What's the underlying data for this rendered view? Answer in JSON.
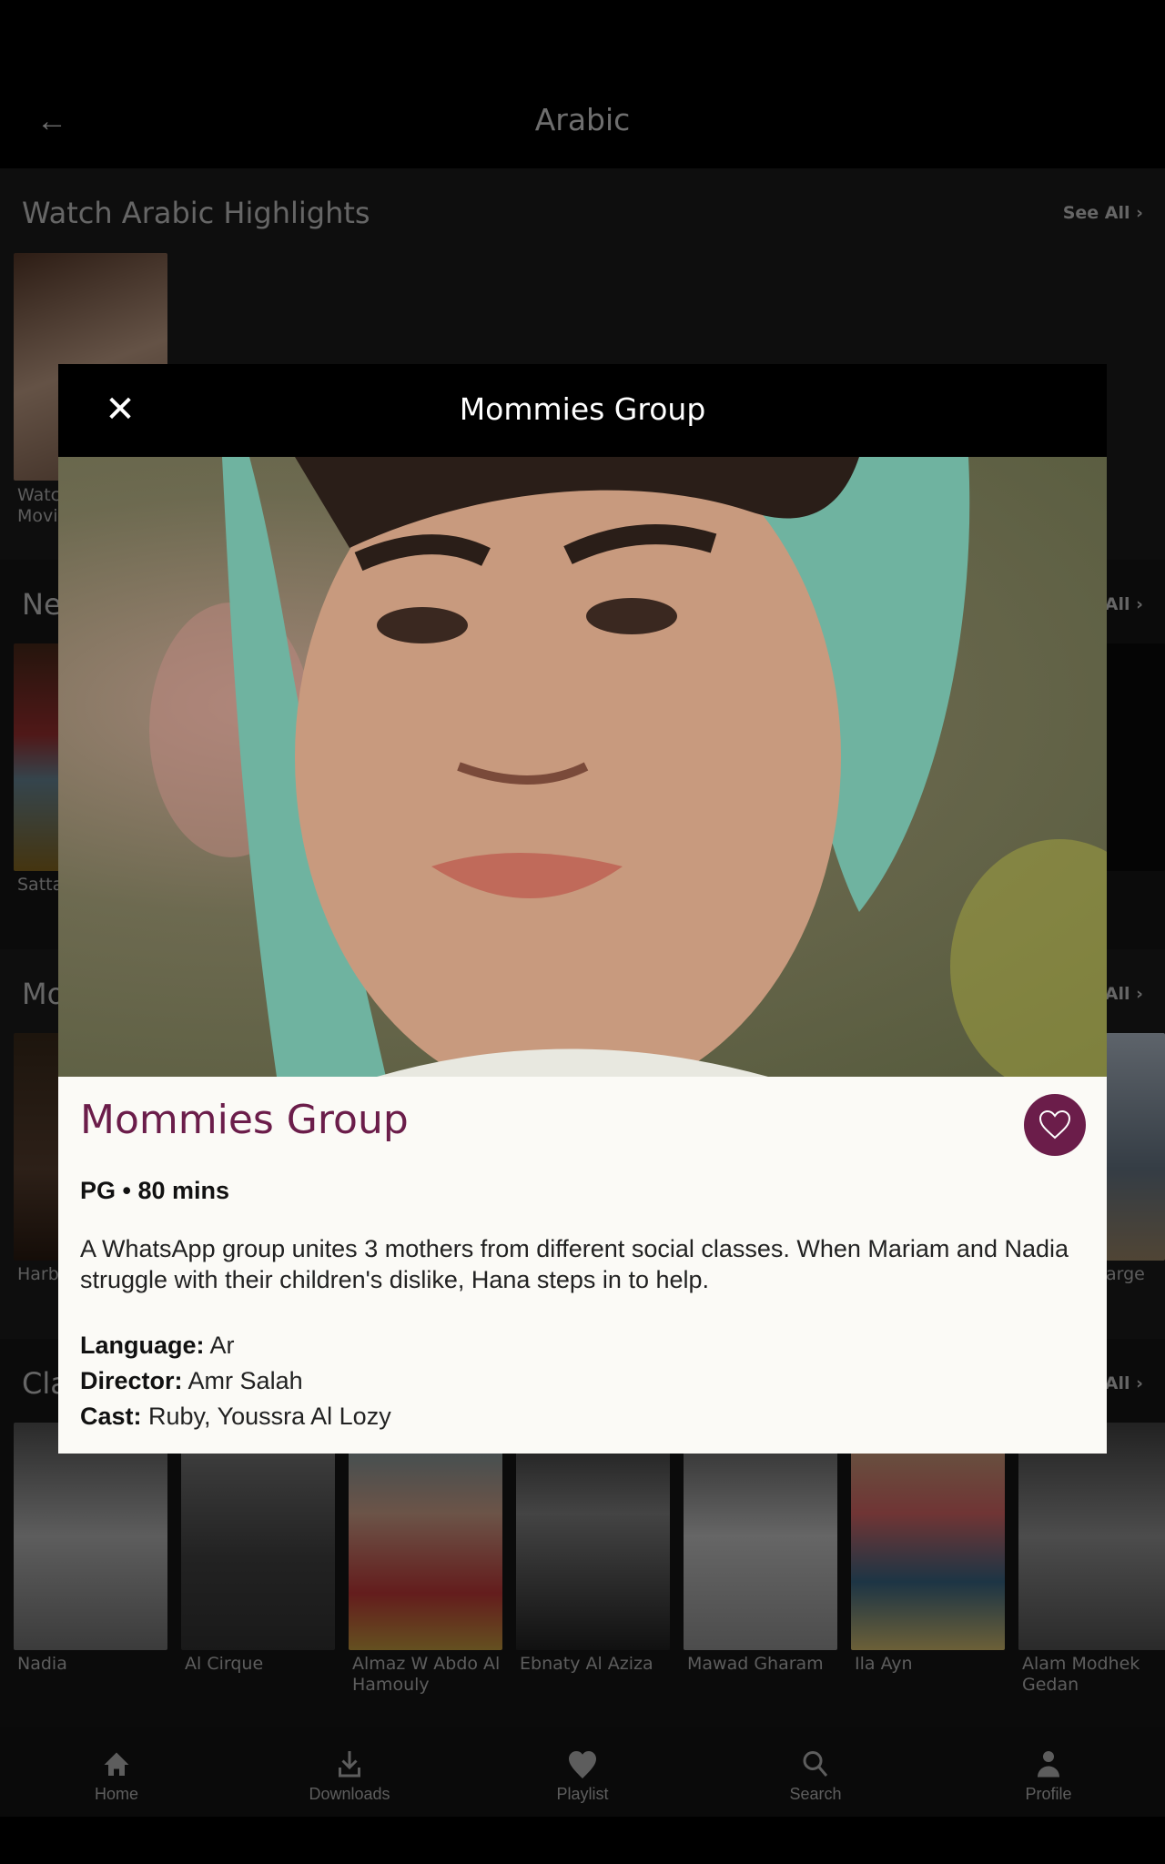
{
  "header": {
    "title": "Arabic",
    "back_icon": "arrow-left-icon"
  },
  "sections": [
    {
      "title": "Watch Arabic Highlights",
      "see_all": "See All",
      "items": [
        {
          "label": "Watc\nMovi"
        }
      ]
    },
    {
      "title": "Ne",
      "see_all": "All",
      "items": [
        {
          "label": "Satta"
        }
      ]
    },
    {
      "title": "Mo",
      "see_all": "All",
      "items": [
        {
          "label": "Harb"
        },
        {
          "label": "arge"
        }
      ]
    },
    {
      "title": "Cla",
      "see_all": "All",
      "items": [
        {
          "label": "Nadia"
        },
        {
          "label": "Al Cirque"
        },
        {
          "label": "Almaz W Abdo Al Hamouly"
        },
        {
          "label": "Ebnaty Al Aziza"
        },
        {
          "label": "Mawad Gharam"
        },
        {
          "label": "Ila Ayn"
        },
        {
          "label": "Alam Modhek Gedan"
        }
      ]
    }
  ],
  "modal": {
    "header_title": "Mommies Group",
    "close_icon": "close-icon",
    "title": "Mommies Group",
    "favorite_icon": "heart-outline-icon",
    "meta": "PG • 80 mins",
    "description": "A WhatsApp group unites 3 mothers from different social classes. When Mariam and Nadia struggle with their children's dislike, Hana steps in to help.",
    "language_label": "Language:",
    "language": "Ar",
    "director_label": "Director:",
    "director": "Amr Salah",
    "cast_label": "Cast:",
    "cast": "Ruby, Youssra Al Lozy"
  },
  "bottom_nav": [
    {
      "label": "Home",
      "icon": "home-icon"
    },
    {
      "label": "Downloads",
      "icon": "download-icon"
    },
    {
      "label": "Playlist",
      "icon": "heart-icon"
    },
    {
      "label": "Search",
      "icon": "search-icon"
    },
    {
      "label": "Profile",
      "icon": "person-icon"
    }
  ],
  "colors": {
    "accent": "#6b1d4a",
    "modal_bg": "#fbfaf6"
  }
}
